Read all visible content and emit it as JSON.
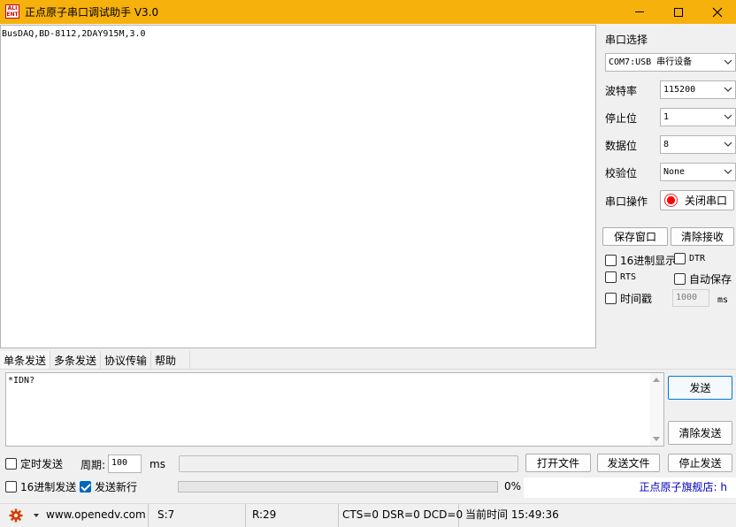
{
  "window": {
    "logo_text": "ALIENTEK",
    "title": "正点原子串口调试助手 V3.0",
    "colors": {
      "titlebar": "#f7b10c",
      "led": "#ff0000",
      "checked": "#0067c0",
      "promo": "#0000c0"
    }
  },
  "receive": {
    "text": "BusDAQ,BD-8112,2DAY915M,3.0"
  },
  "serial": {
    "section_label": "串口选择",
    "port": "COM7:USB 串行设备",
    "baud_label": "波特率",
    "baud": "115200",
    "stopbit_label": "停止位",
    "stopbit": "1",
    "databit_label": "数据位",
    "databit": "8",
    "parity_label": "校验位",
    "parity": "None",
    "op_label": "串口操作",
    "op_button": "关闭串口",
    "save_window": "保存窗口",
    "clear_recv": "清除接收",
    "hex_display": "16进制显示",
    "dtr": "DTR",
    "rts": "RTS",
    "auto_save": "自动保存",
    "timestamp": "时间戳",
    "timestamp_value": "1000",
    "timestamp_unit": "ms"
  },
  "tabs": [
    "单条发送",
    "多条发送",
    "协议传输",
    "帮助"
  ],
  "send": {
    "text": "*IDN?",
    "send_button": "发送",
    "clear_send": "清除发送",
    "timed_send": "定时发送",
    "period_label": "周期:",
    "period_value": "100",
    "period_unit": "ms",
    "open_file": "打开文件",
    "send_file": "发送文件",
    "stop_send": "停止发送",
    "hex_send": "16进制发送",
    "send_newline": "发送新行",
    "progress_percent": "0%",
    "progress_value": 0,
    "promo": "正点原子旗舰店: h"
  },
  "statusbar": {
    "gear_icon": "gear-icon",
    "website": "www.openedv.com",
    "sent": "S:7",
    "received": "R:29",
    "signals": "CTS=0 DSR=0 DCD=0",
    "time": "当前时间 15:49:36"
  }
}
